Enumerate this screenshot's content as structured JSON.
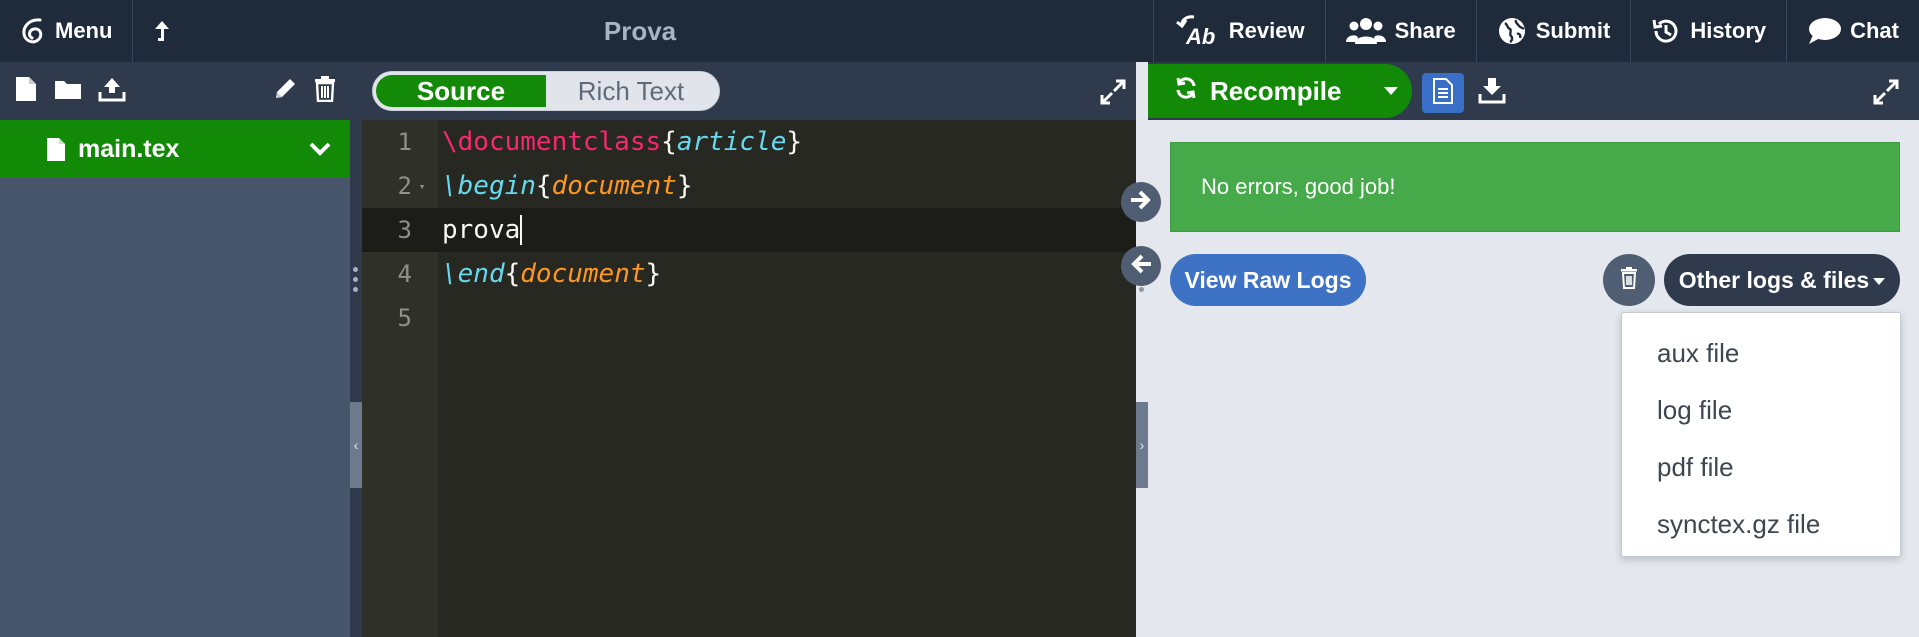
{
  "topbar": {
    "menu_label": "Menu",
    "project_title": "Prova",
    "review_label": "Review",
    "share_label": "Share",
    "submit_label": "Submit",
    "history_label": "History",
    "chat_label": "Chat"
  },
  "file_tree": {
    "items": [
      {
        "name": "main.tex",
        "selected": true
      }
    ]
  },
  "editor": {
    "mode_source": "Source",
    "mode_rich": "Rich Text",
    "active_mode": "Source",
    "lines": [
      {
        "num": "1",
        "cmd": "\\documentclass",
        "open": "{",
        "arg": "article",
        "close": "}"
      },
      {
        "num": "2",
        "cmd": "\\begin",
        "open": "{",
        "arg": "document",
        "close": "}"
      },
      {
        "num": "3",
        "text": "prova"
      },
      {
        "num": "4",
        "cmd": "\\end",
        "open": "{",
        "arg": "document",
        "close": "}"
      },
      {
        "num": "5",
        "text": ""
      }
    ],
    "active_line": "3"
  },
  "pdf": {
    "recompile_label": "Recompile",
    "success_message": "No errors, good job!",
    "view_raw_logs_label": "View Raw Logs",
    "other_logs_label": "Other logs & files",
    "menu_items": [
      "aux file",
      "log file",
      "pdf file",
      "synctex.gz file"
    ]
  },
  "colors": {
    "topbar_bg": "#1f2a3a",
    "green": "#138a07",
    "success_green": "#46a94a",
    "blue": "#3e72c5"
  }
}
